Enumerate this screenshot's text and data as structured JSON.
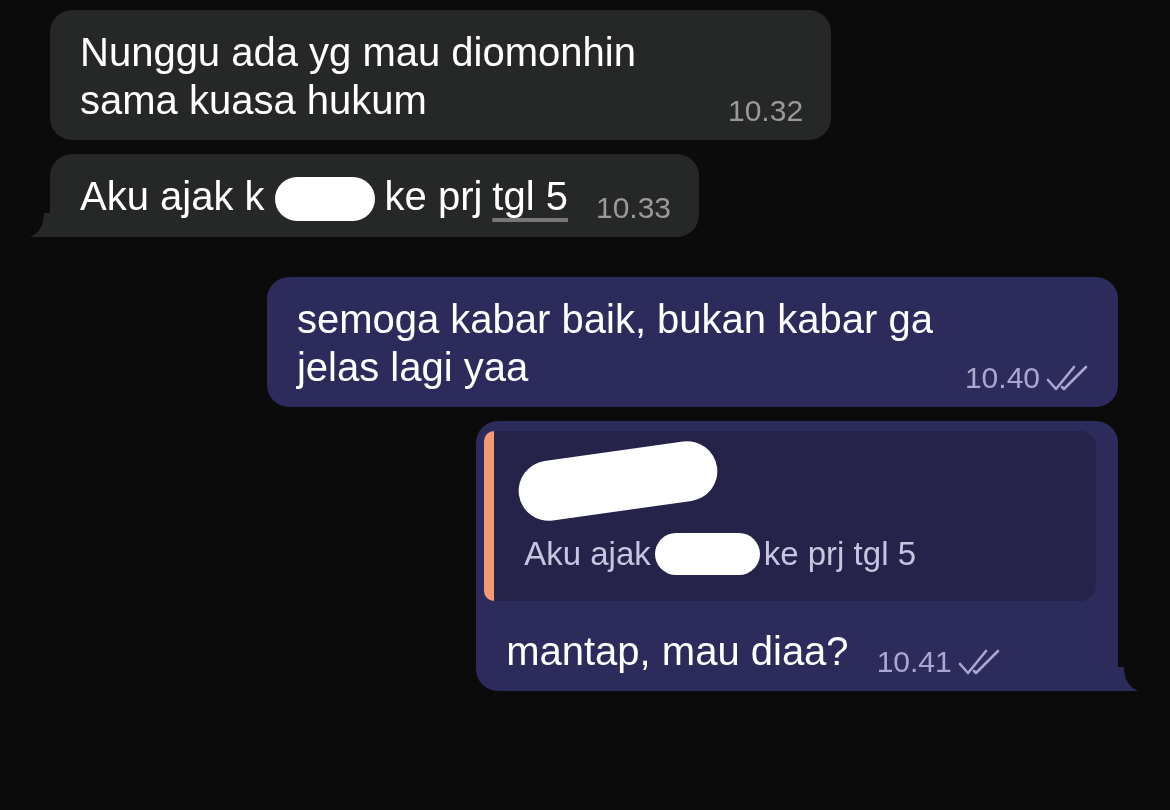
{
  "messages": [
    {
      "outgoing": false,
      "tail": false,
      "parts": [
        {
          "kind": "plain",
          "text": "Nunggu ada yg mau diomonhin sama kuasa hukum"
        }
      ],
      "time": "10.32"
    },
    {
      "outgoing": false,
      "tail": true,
      "parts": [
        {
          "kind": "plain",
          "text": "Aku ajak k"
        },
        {
          "kind": "redacted"
        },
        {
          "kind": "plain",
          "text": "ke prj"
        },
        {
          "kind": "link",
          "text": "tgl 5"
        }
      ],
      "time": "10.33"
    },
    {
      "outgoing": true,
      "tail": false,
      "parts": [
        {
          "kind": "plain",
          "text": "semoga kabar baik, bukan kabar ga jelas lagi yaa"
        }
      ],
      "time": "10.40",
      "read": true
    },
    {
      "outgoing": true,
      "tail": true,
      "reply": {
        "author_redacted": true,
        "parts": [
          {
            "kind": "plain",
            "text": "Aku ajak"
          },
          {
            "kind": "redacted"
          },
          {
            "kind": "plain",
            "text": "ke prj tgl 5"
          }
        ]
      },
      "parts": [
        {
          "kind": "plain",
          "text": "mantap, mau diaa?"
        }
      ],
      "time": "10.41",
      "read": true
    }
  ]
}
